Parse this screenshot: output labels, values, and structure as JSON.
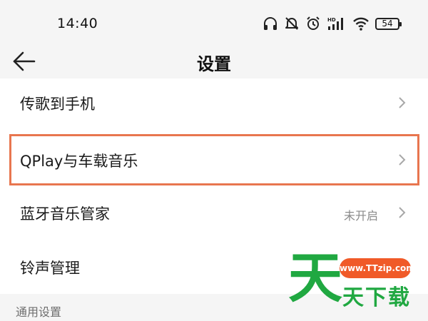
{
  "status_bar": {
    "time": "14:40",
    "network_label": "HD",
    "battery_level": "54",
    "icons": [
      "headphones-icon",
      "mute-icon",
      "alarm-icon",
      "signal-icon",
      "wifi-icon",
      "battery-icon"
    ]
  },
  "header": {
    "title": "设置",
    "back_icon": "arrow-left-icon"
  },
  "settings": {
    "rows": [
      {
        "label": "传歌到手机",
        "value": ""
      },
      {
        "label": "QPlay与车载音乐",
        "value": "",
        "highlighted": true
      },
      {
        "label": "蓝牙音乐管家",
        "value": "未开启"
      },
      {
        "label": "铃声管理",
        "value": ""
      }
    ]
  },
  "section": {
    "general_title": "通用设置"
  },
  "watermark": {
    "big_char": "天",
    "url": "www.TTzip.com",
    "text": "天下载"
  },
  "colors": {
    "highlight_border": "#e8764f",
    "watermark_green": "#20a841",
    "watermark_orange": "#f05a28"
  }
}
